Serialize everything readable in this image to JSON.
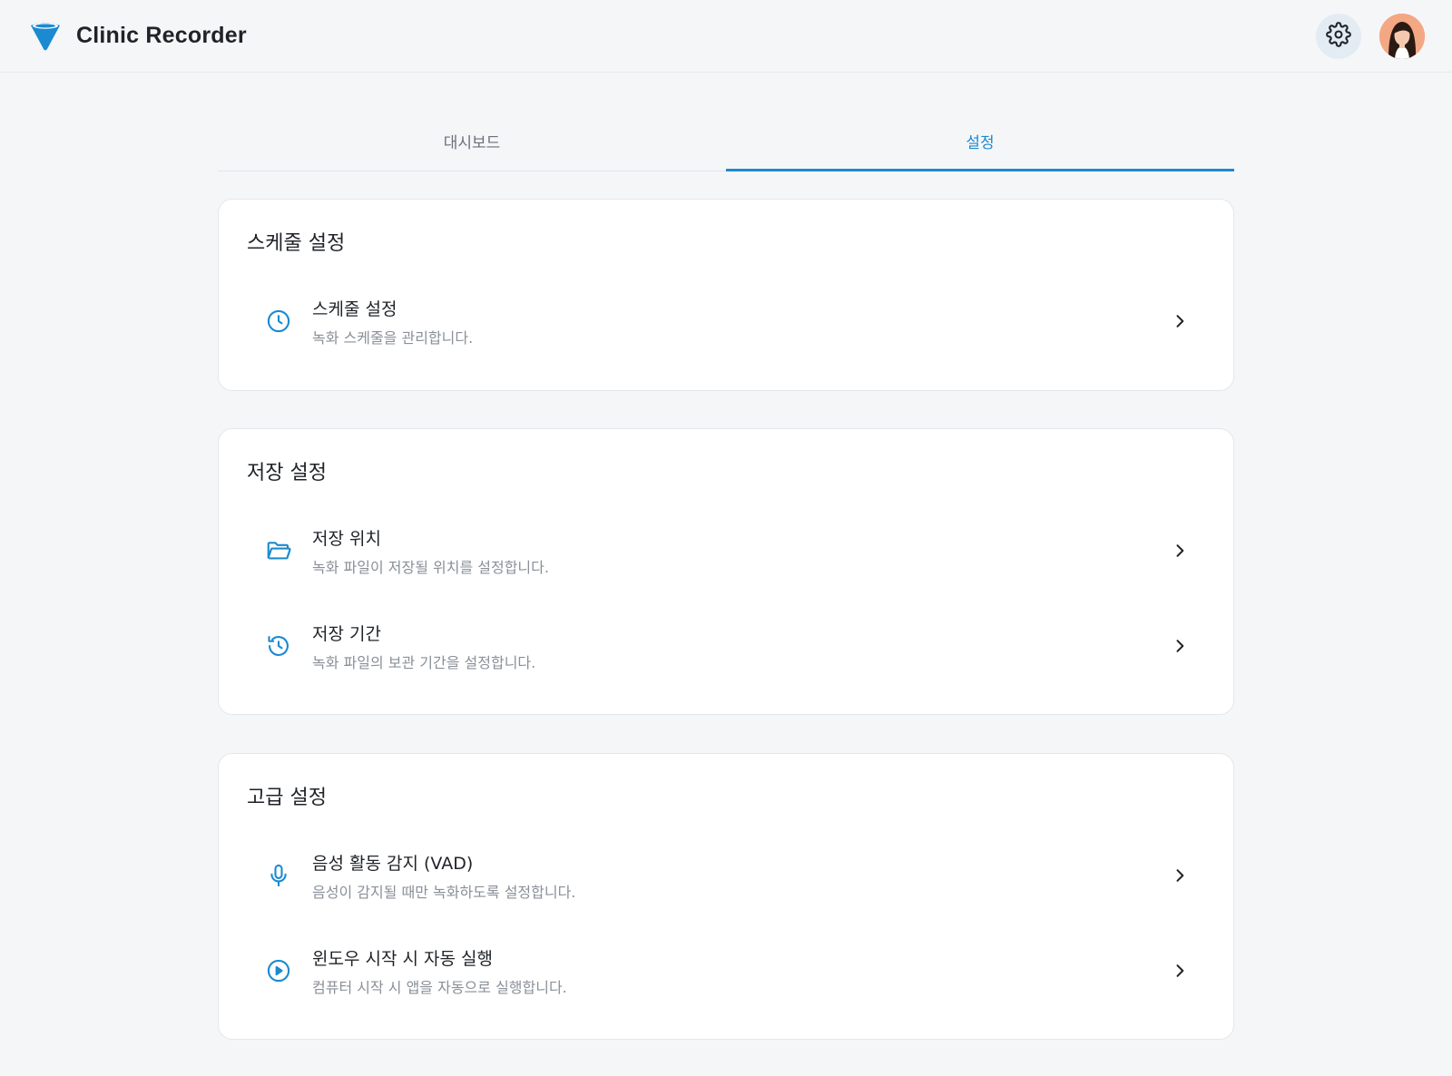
{
  "app": {
    "title": "Clinic Recorder",
    "accent_color": "#1b8ad0",
    "logo_icon": "funnel-logo-icon",
    "settings_icon": "gear-icon",
    "avatar_icon": "user-avatar"
  },
  "tabs": [
    {
      "label": "대시보드",
      "active": false
    },
    {
      "label": "설정",
      "active": true
    }
  ],
  "sections": [
    {
      "title": "스케줄 설정",
      "items": [
        {
          "icon": "clock-icon",
          "label": "스케줄 설정",
          "description": "녹화 스케줄을 관리합니다."
        }
      ]
    },
    {
      "title": "저장 설정",
      "items": [
        {
          "icon": "folder-open-icon",
          "label": "저장 위치",
          "description": "녹화 파일이 저장될 위치를 설정합니다."
        },
        {
          "icon": "history-icon",
          "label": "저장 기간",
          "description": "녹화 파일의 보관 기간을 설정합니다."
        }
      ]
    },
    {
      "title": "고급 설정",
      "items": [
        {
          "icon": "microphone-icon",
          "label": "음성 활동 감지 (VAD)",
          "description": "음성이 감지될 때만 녹화하도록 설정합니다."
        },
        {
          "icon": "play-circle-icon",
          "label": "윈도우 시작 시 자동 실행",
          "description": "컴퓨터 시작 시 앱을 자동으로 실행합니다."
        }
      ]
    }
  ]
}
